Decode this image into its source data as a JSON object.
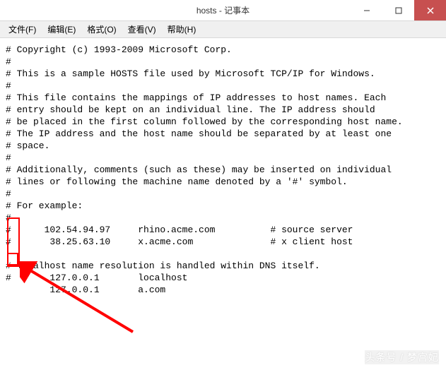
{
  "window": {
    "title": "hosts - 记事本"
  },
  "menu": {
    "file": "文件(F)",
    "edit": "编辑(E)",
    "format": "格式(O)",
    "view": "查看(V)",
    "help": "帮助(H)"
  },
  "content": {
    "lines": [
      "# Copyright (c) 1993-2009 Microsoft Corp.",
      "#",
      "# This is a sample HOSTS file used by Microsoft TCP/IP for Windows.",
      "#",
      "# This file contains the mappings of IP addresses to host names. Each",
      "# entry should be kept on an individual line. The IP address should",
      "# be placed in the first column followed by the corresponding host name.",
      "# The IP address and the host name should be separated by at least one",
      "# space.",
      "#",
      "# Additionally, comments (such as these) may be inserted on individual",
      "# lines or following the machine name denoted by a '#' symbol.",
      "#",
      "# For example:",
      "#",
      "#      102.54.94.97     rhino.acme.com          # source server",
      "#       38.25.63.10     x.acme.com              # x client host",
      "",
      "# localhost name resolution is handled within DNS itself.",
      "#       127.0.0.1       localhost",
      "        127.0.0.1       a.com"
    ]
  },
  "watermark": "头条号 / 梦宫妃"
}
